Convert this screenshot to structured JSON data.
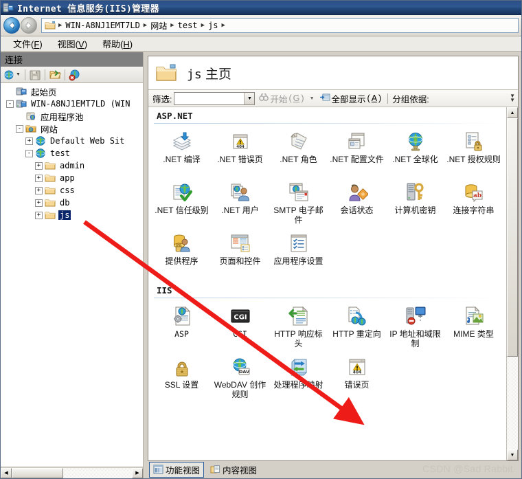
{
  "window": {
    "title": "Internet 信息服务(IIS)管理器",
    "app_icon": "server-icon"
  },
  "navigation": {
    "back_label": "后退",
    "forward_label": "前进",
    "breadcrumb": [
      {
        "label": "WIN-A8NJ1EMT7LD",
        "mono": true
      },
      {
        "label": "网站",
        "mono": false
      },
      {
        "label": "test",
        "mono": true
      },
      {
        "label": "js",
        "mono": true
      }
    ]
  },
  "menubar": {
    "items": [
      {
        "label": "文件",
        "accel": "F"
      },
      {
        "label": "视图",
        "accel": "V"
      },
      {
        "label": "帮助",
        "accel": "H"
      }
    ]
  },
  "connections": {
    "header": "连接",
    "toolbar": [
      {
        "name": "connect-to-icon",
        "label": "连接到"
      },
      {
        "name": "save-connections-icon",
        "label": "保存连接"
      },
      {
        "name": "open-connection-icon",
        "label": "打开连接"
      },
      {
        "name": "delete-connection-icon",
        "label": "删除连接"
      }
    ],
    "tree": [
      {
        "label": "起始页",
        "depth": 0,
        "expander": "",
        "icon": "start-page-icon",
        "cjk": true,
        "selected": false
      },
      {
        "label": "WIN-A8NJ1EMT7LD (WIN",
        "depth": 0,
        "expander": "-",
        "icon": "server-node-icon",
        "cjk": false,
        "selected": false
      },
      {
        "label": "应用程序池",
        "depth": 1,
        "expander": "",
        "icon": "app-pool-icon",
        "cjk": true,
        "selected": false
      },
      {
        "label": "网站",
        "depth": 1,
        "expander": "-",
        "icon": "sites-icon",
        "cjk": true,
        "selected": false
      },
      {
        "label": "Default Web Sit",
        "depth": 2,
        "expander": "+",
        "icon": "website-icon",
        "cjk": false,
        "selected": false
      },
      {
        "label": "test",
        "depth": 2,
        "expander": "-",
        "icon": "website-icon",
        "cjk": false,
        "selected": false
      },
      {
        "label": "admin",
        "depth": 3,
        "expander": "+",
        "icon": "folder-icon",
        "cjk": false,
        "selected": false
      },
      {
        "label": "app",
        "depth": 3,
        "expander": "+",
        "icon": "folder-icon",
        "cjk": false,
        "selected": false
      },
      {
        "label": "css",
        "depth": 3,
        "expander": "+",
        "icon": "folder-icon",
        "cjk": false,
        "selected": false
      },
      {
        "label": "db",
        "depth": 3,
        "expander": "+",
        "icon": "folder-icon",
        "cjk": false,
        "selected": false
      },
      {
        "label": "js",
        "depth": 3,
        "expander": "+",
        "icon": "folder-icon",
        "cjk": false,
        "selected": true
      }
    ]
  },
  "page": {
    "title_name": "js",
    "title_suffix": "主页",
    "icon": "folder-icon"
  },
  "filterbar": {
    "filter_label": "筛选:",
    "filter_value": "",
    "filter_placeholder": "",
    "go_label": "开始",
    "go_accel": "G",
    "show_all_label": "全部显示",
    "show_all_accel": "A",
    "group_by_label": "分组依据:"
  },
  "sections": [
    {
      "title": "ASP.NET",
      "items": [
        {
          "label": ".NET 编译",
          "icon": "net-compilation-icon"
        },
        {
          "label": ".NET 错误页",
          "icon": "net-error-pages-icon"
        },
        {
          "label": ".NET 角色",
          "icon": "net-roles-icon"
        },
        {
          "label": ".NET 配置文件",
          "icon": "net-profile-icon"
        },
        {
          "label": ".NET 全球化",
          "icon": "net-globalization-icon"
        },
        {
          "label": ".NET 授权规则",
          "icon": "net-authorization-rules-icon"
        },
        {
          "label": ".NET 信任级别",
          "icon": "net-trust-levels-icon"
        },
        {
          "label": ".NET 用户",
          "icon": "net-users-icon"
        },
        {
          "label": "SMTP 电子邮件",
          "icon": "smtp-email-icon"
        },
        {
          "label": "会话状态",
          "icon": "session-state-icon"
        },
        {
          "label": "计算机密钥",
          "icon": "machine-key-icon"
        },
        {
          "label": "连接字符串",
          "icon": "connection-strings-icon"
        },
        {
          "label": "提供程序",
          "icon": "providers-icon"
        },
        {
          "label": "页面和控件",
          "icon": "pages-and-controls-icon"
        },
        {
          "label": "应用程序设置",
          "icon": "application-settings-icon"
        }
      ]
    },
    {
      "title": "IIS",
      "items": [
        {
          "label": "ASP",
          "icon": "asp-icon"
        },
        {
          "label": "CGI",
          "icon": "cgi-icon"
        },
        {
          "label": "HTTP 响应标头",
          "icon": "http-response-headers-icon"
        },
        {
          "label": "HTTP 重定向",
          "icon": "http-redirect-icon"
        },
        {
          "label": "IP 地址和域限制",
          "icon": "ip-domain-restrictions-icon"
        },
        {
          "label": "MIME 类型",
          "icon": "mime-types-icon"
        },
        {
          "label": "SSL 设置",
          "icon": "ssl-settings-icon"
        },
        {
          "label": "WebDAV 创作规则",
          "icon": "webdav-authoring-rules-icon"
        },
        {
          "label": "处理程序映射",
          "icon": "handler-mappings-icon"
        },
        {
          "label": "错误页",
          "icon": "error-pages-icon"
        }
      ]
    }
  ],
  "viewtabs": [
    {
      "label": "功能视图",
      "icon": "features-view-icon",
      "active": true
    },
    {
      "label": "内容视图",
      "icon": "content-view-icon",
      "active": false
    }
  ],
  "watermark": "CSDN @Sad Rabbit",
  "annotation": {
    "type": "arrow",
    "color": "#ee1c19",
    "from_label": "js",
    "to_label": "处理程序映射"
  },
  "colors": {
    "titlebar": "#2e5791",
    "selection": "#0a246a",
    "pane_header": "#808080",
    "chrome": "#d4d0c8",
    "annotation": "#ee1c19"
  }
}
